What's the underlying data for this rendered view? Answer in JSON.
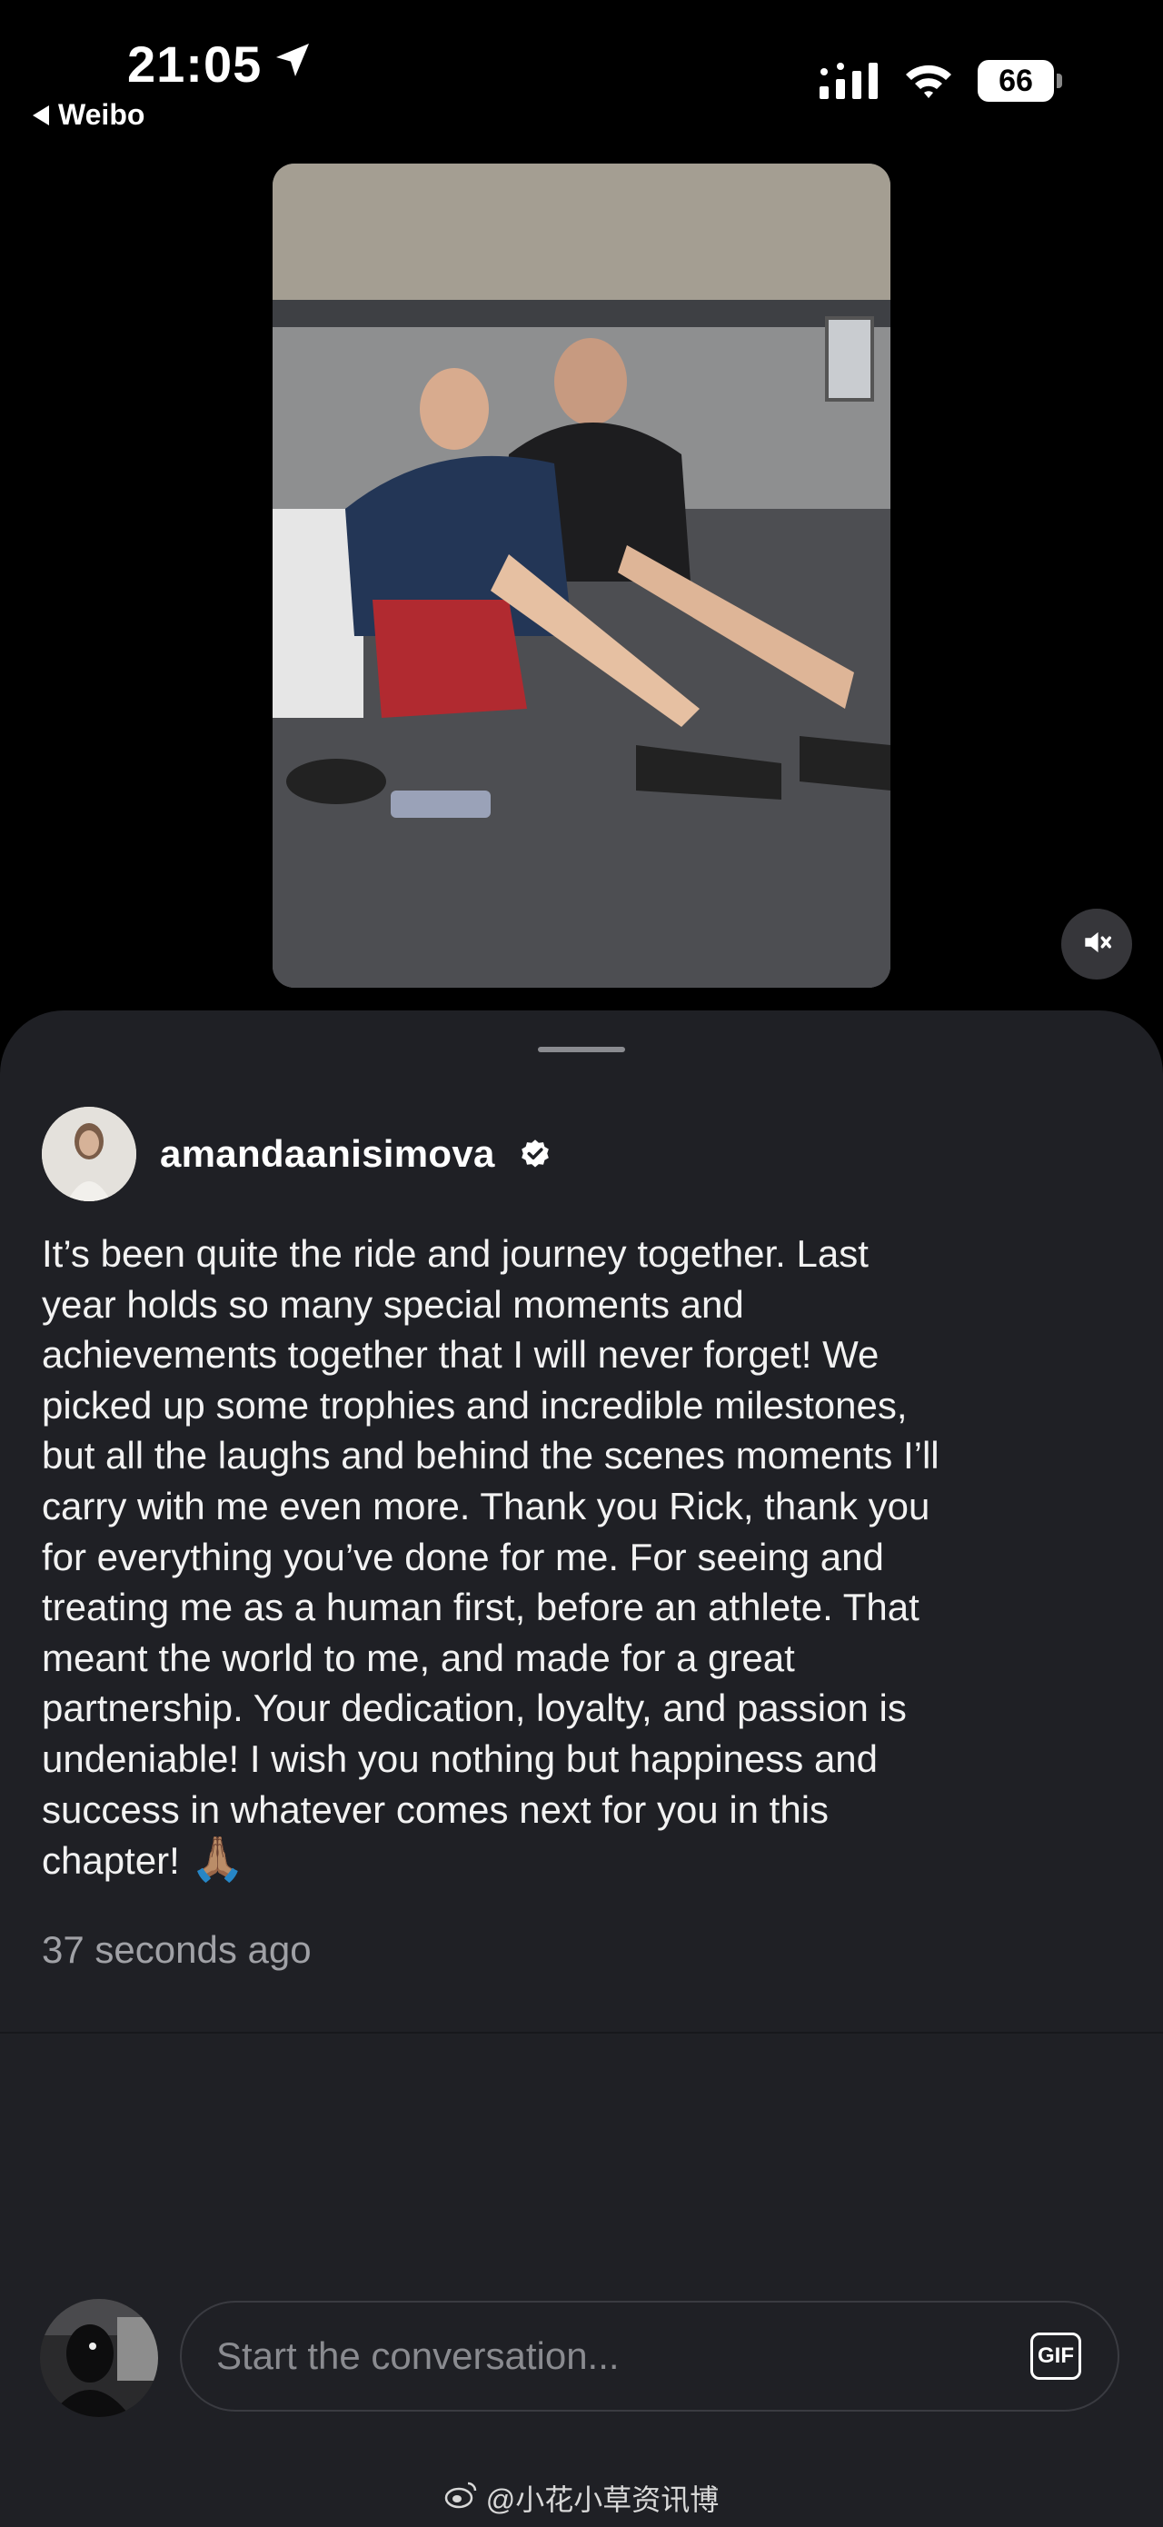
{
  "status_bar": {
    "time": "21:05",
    "back_app_label": "Weibo",
    "battery": "66"
  },
  "post": {
    "username": "amandaanisimova",
    "caption": "It’s been quite the ride and journey together. Last\nyear holds so many special moments and\nachievements together that I will never forget! We\npicked up some trophies and incredible milestones,\nbut all the laughs and behind the scenes moments I’ll\ncarry with me even more. Thank you Rick, thank you\nfor everything you’ve done for me. For seeing and\ntreating me as a human first, before an athlete. That\nmeant the world to me, and made for a great\npartnership. Your dedication, loyalty, and passion is\nundeniable! I wish you nothing but happiness and\nsuccess in whatever comes next for you in this\nchapter!",
    "caption_emoji": "🙏🏽",
    "timestamp": "37 seconds ago"
  },
  "composer": {
    "placeholder": "Start the conversation...",
    "gif_label": "GIF"
  },
  "watermark": {
    "text": "@小花小草资讯博"
  },
  "icons": {
    "location": "location-arrow-icon",
    "signal": "cellular-signal-icon",
    "wifi": "wifi-icon",
    "mute": "speaker-muted-icon",
    "verified": "verified-badge-icon",
    "weibo": "weibo-logo-icon"
  }
}
